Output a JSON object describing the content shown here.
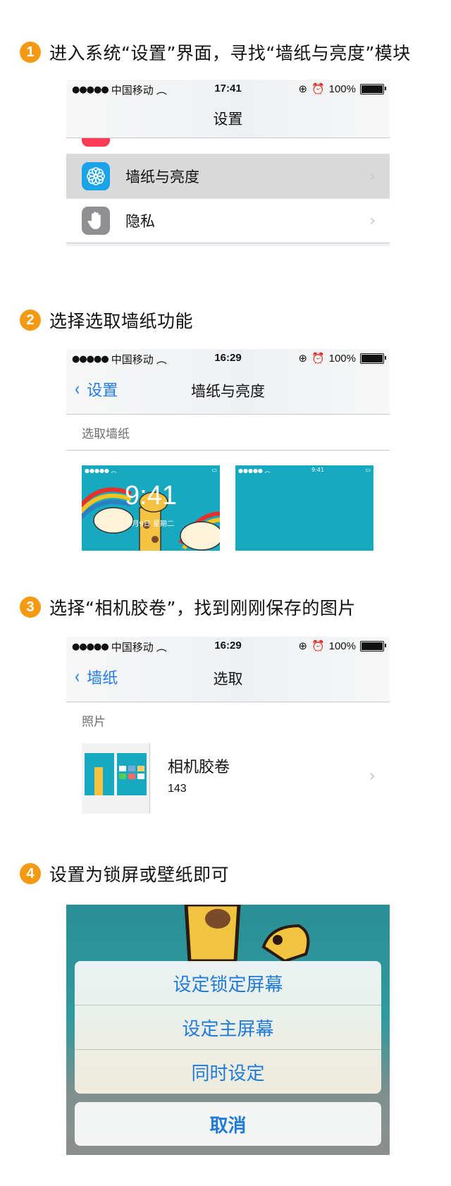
{
  "steps": [
    {
      "num": "1",
      "text": "进入系统“设置”界面，寻找“墙纸与亮度”模块"
    },
    {
      "num": "2",
      "text": "选择选取墙纸功能"
    },
    {
      "num": "3",
      "text": "选择“相机胶卷”，找到刚刚保存的图片"
    },
    {
      "num": "4",
      "text": "设置为锁屏或壁纸即可"
    }
  ],
  "status": {
    "carrier": "中国移动",
    "battery": "100%",
    "battery_level": 1.0
  },
  "screen1": {
    "time": "17:41",
    "title": "设置",
    "rows": [
      {
        "label": "墙纸与亮度",
        "icon": "flower-icon",
        "highlighted": true
      },
      {
        "label": "隐私",
        "icon": "hand-icon"
      }
    ]
  },
  "screen2": {
    "time": "16:29",
    "back": "设置",
    "title": "墙纸与亮度",
    "section": "选取墙纸",
    "lock_time": "9:41",
    "lock_date": "1月9日 星期二",
    "home_time": "9:41"
  },
  "screen3": {
    "time": "16:29",
    "back": "墙纸",
    "title": "选取",
    "section": "照片",
    "album": {
      "name": "相机胶卷",
      "count": "143"
    }
  },
  "screen4": {
    "options": [
      "设定锁定屏幕",
      "设定主屏幕",
      "同时设定"
    ],
    "cancel": "取消"
  },
  "colors": {
    "accent": "#1e7bf0",
    "step": "#f39a12",
    "wallpaper": "#16a9c0"
  }
}
